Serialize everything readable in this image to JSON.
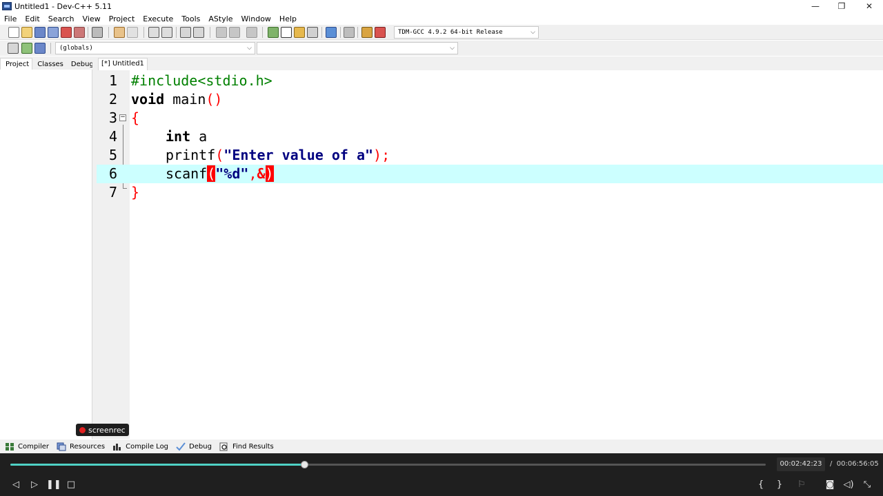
{
  "window": {
    "title": "Untitled1 - Dev-C++ 5.11",
    "minimize": "—",
    "maximize": "❐",
    "close": "✕"
  },
  "menu": [
    "File",
    "Edit",
    "Search",
    "View",
    "Project",
    "Execute",
    "Tools",
    "AStyle",
    "Window",
    "Help"
  ],
  "toolbar": {
    "compiler_select": "TDM-GCC 4.9.2 64-bit Release",
    "scope_select": "(globals)",
    "symbol_select": ""
  },
  "left_tabs": [
    "Project",
    "Classes",
    "Debug"
  ],
  "editor_tab": "[*] Untitled1",
  "code": {
    "line_numbers": [
      "1",
      "2",
      "3",
      "4",
      "5",
      "6",
      "7"
    ],
    "l1": "#include<stdio.h>",
    "l2_kw": "void",
    "l2_rest": " main",
    "l2_paren": "()",
    "l3_brace": "{",
    "l4_kw": "int",
    "l4_rest": " a",
    "l5_func": "printf",
    "l5_open": "(",
    "l5_str": "\"Enter value of a\"",
    "l5_close": ");",
    "l6_func": "scanf",
    "l6_open": "(",
    "l6_str": "\"%d\"",
    "l6_comma": ",",
    "l6_amp": "&",
    "l6_close": ")",
    "l7_brace": "}",
    "fold_glyph": "−"
  },
  "watermark": "screenrec",
  "bottom_tabs": [
    "Compiler",
    "Resources",
    "Compile Log",
    "Debug",
    "Find Results"
  ],
  "player": {
    "current_time": "00:02:42:23",
    "separator": "/",
    "total_time": "00:06:56:05",
    "progress": 0.39
  },
  "colors": {
    "highlight_line": "#ccffff",
    "preprocessor": "#008000",
    "symbol": "#ff0000",
    "string": "#000080",
    "progress": "#4fd1c5"
  }
}
